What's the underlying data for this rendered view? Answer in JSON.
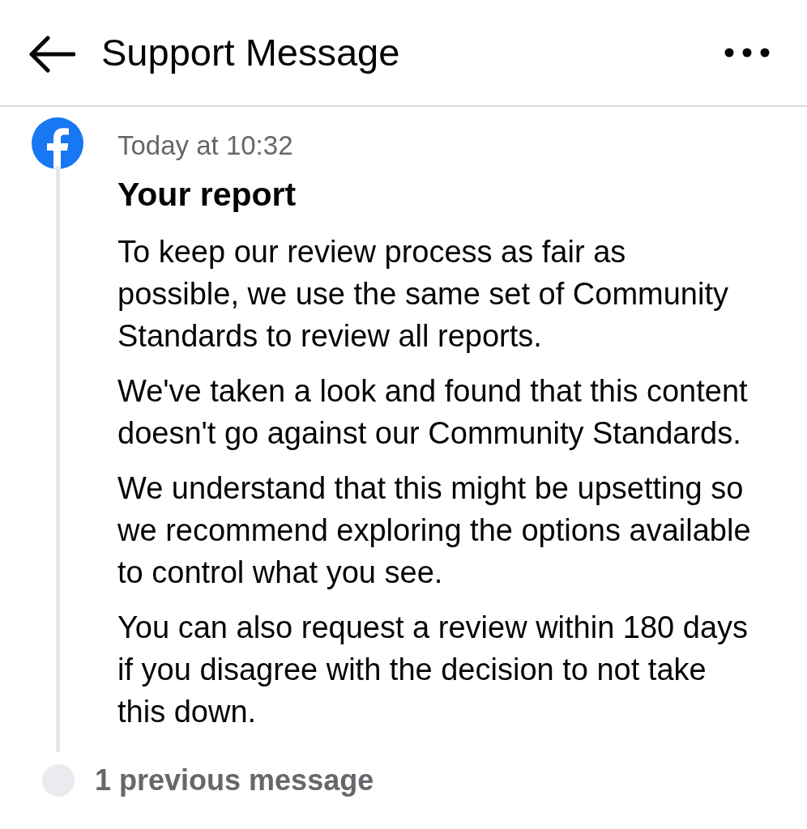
{
  "header": {
    "title": "Support Message"
  },
  "message": {
    "timestamp": "Today at 10:32",
    "title": "Your report",
    "paragraphs": [
      "To keep our review process as fair as possible, we use the same set of Community Standards to review all reports.",
      "We've taken a look and found that this content doesn't go against our Community Standards.",
      "We understand that this might be upsetting so we recommend exploring the options available to control what you see.",
      "You can also request a review within 180 days if you disagree with the decision to not take this down."
    ]
  },
  "previous": {
    "label": "1 previous message"
  }
}
